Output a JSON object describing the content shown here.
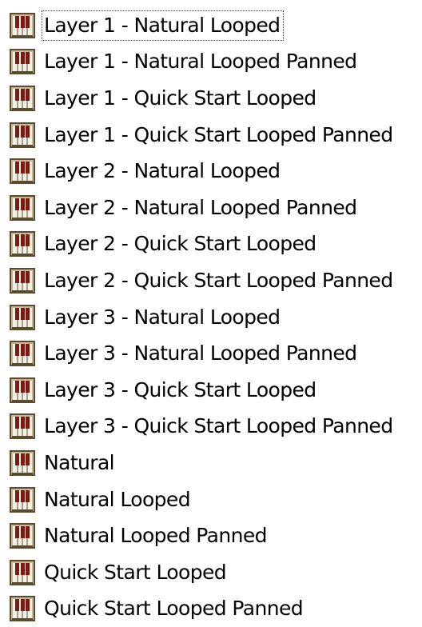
{
  "list": {
    "items": [
      {
        "label": "Layer 1 - Natural Looped",
        "icon": "instrument-file-icon",
        "focused": true
      },
      {
        "label": "Layer 1 - Natural Looped Panned",
        "icon": "instrument-file-icon"
      },
      {
        "label": "Layer 1 - Quick Start Looped",
        "icon": "instrument-file-icon"
      },
      {
        "label": "Layer 1 - Quick Start Looped Panned",
        "icon": "instrument-file-icon"
      },
      {
        "label": "Layer 2 - Natural Looped",
        "icon": "instrument-file-icon"
      },
      {
        "label": "Layer 2 - Natural Looped Panned",
        "icon": "instrument-file-icon"
      },
      {
        "label": "Layer 2 - Quick Start Looped",
        "icon": "instrument-file-icon"
      },
      {
        "label": "Layer 2 - Quick Start Looped Panned",
        "icon": "instrument-file-icon"
      },
      {
        "label": "Layer 3 - Natural Looped",
        "icon": "instrument-file-icon"
      },
      {
        "label": "Layer 3 - Natural Looped Panned",
        "icon": "instrument-file-icon"
      },
      {
        "label": "Layer 3 - Quick Start Looped",
        "icon": "instrument-file-icon"
      },
      {
        "label": "Layer 3 - Quick Start Looped Panned",
        "icon": "instrument-file-icon"
      },
      {
        "label": "Natural",
        "icon": "instrument-file-icon"
      },
      {
        "label": "Natural Looped",
        "icon": "instrument-file-icon"
      },
      {
        "label": "Natural Looped Panned",
        "icon": "instrument-file-icon"
      },
      {
        "label": "Quick Start Looped",
        "icon": "instrument-file-icon"
      },
      {
        "label": "Quick Start Looped Panned",
        "icon": "instrument-file-icon"
      }
    ]
  },
  "colors": {
    "icon_frame": "#5a4a2e",
    "icon_keys_white": "#f3f0e6",
    "icon_keys_black": "#7a1a10",
    "icon_panel": "#c8b89a",
    "focus_border": "#444444"
  }
}
